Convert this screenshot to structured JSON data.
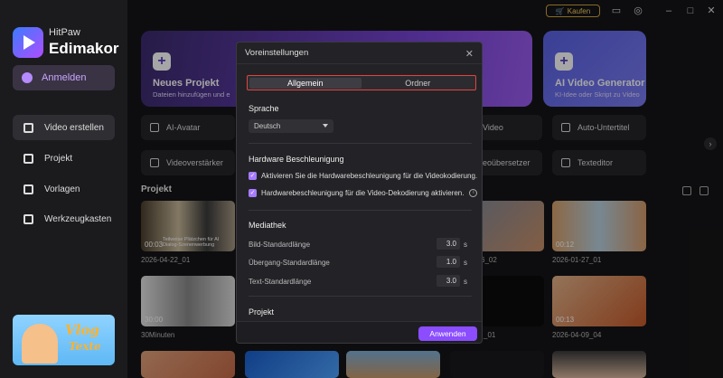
{
  "app": {
    "brand_small": "HitPaw",
    "brand_big": "Edimakor"
  },
  "topbar": {
    "buy_label": "Kaufen"
  },
  "sidebar": {
    "login_label": "Anmelden",
    "items": [
      {
        "label": "Video erstellen"
      },
      {
        "label": "Projekt"
      },
      {
        "label": "Vorlagen"
      },
      {
        "label": "Werkzeugkasten"
      }
    ],
    "promo_line1": "Vlog",
    "promo_line2": "Texte"
  },
  "hero": {
    "left_title": "Neues Projekt",
    "left_sub": "Dateien hinzufügen und e",
    "right_title": "AI Video Generator",
    "right_sub": "KI-Idee oder Skript zu Video"
  },
  "tools": {
    "ai_avatar": "AI-Avatar",
    "video": "Video",
    "auto_subtitle": "Auto-Untertitel",
    "enhancer": "Videoverstärker",
    "translator": "eoübersetzer",
    "text_editor": "Texteditor"
  },
  "projects": {
    "title": "Projekt",
    "items": [
      {
        "duration": "00:03",
        "caption": "2026-04-22_01",
        "overlay": "Teilweise Plätzchen für AI Dialog-Szenenwerbung"
      },
      {
        "duration": "",
        "caption": "6_02"
      },
      {
        "duration": "00:12",
        "caption": "2026-01-27_01"
      },
      {
        "duration": "30:00",
        "caption": "30Minuten"
      },
      {
        "duration": "",
        "caption": "_01"
      },
      {
        "duration": "00:13",
        "caption": "2026-04-09_04"
      }
    ]
  },
  "dialog": {
    "title": "Voreinstellungen",
    "tabs": [
      {
        "label": "Allgemein"
      },
      {
        "label": "Ordner"
      }
    ],
    "language_section": "Sprache",
    "language_value": "Deutsch",
    "hw_section": "Hardware Beschleunigung",
    "hw_encode": "Aktivieren Sie die Hardwarebeschleunigung für die Videokodierung.",
    "hw_decode": "Hardwarebeschleunigung für die Video-Dekodierung aktivieren.",
    "media_section": "Mediathek",
    "image_len_label": "Bild-Standardlänge",
    "image_len_value": "3.0",
    "trans_len_label": "Übergang-Standardlänge",
    "trans_len_value": "1.0",
    "text_len_label": "Text-Standardlänge",
    "text_len_value": "3.0",
    "unit": "s",
    "project_section": "Projekt",
    "apply_label": "Anwenden"
  },
  "colors": {
    "accent": "#8b4dff",
    "highlight_border": "#e0453e",
    "buy_gold": "#d2a53a"
  }
}
